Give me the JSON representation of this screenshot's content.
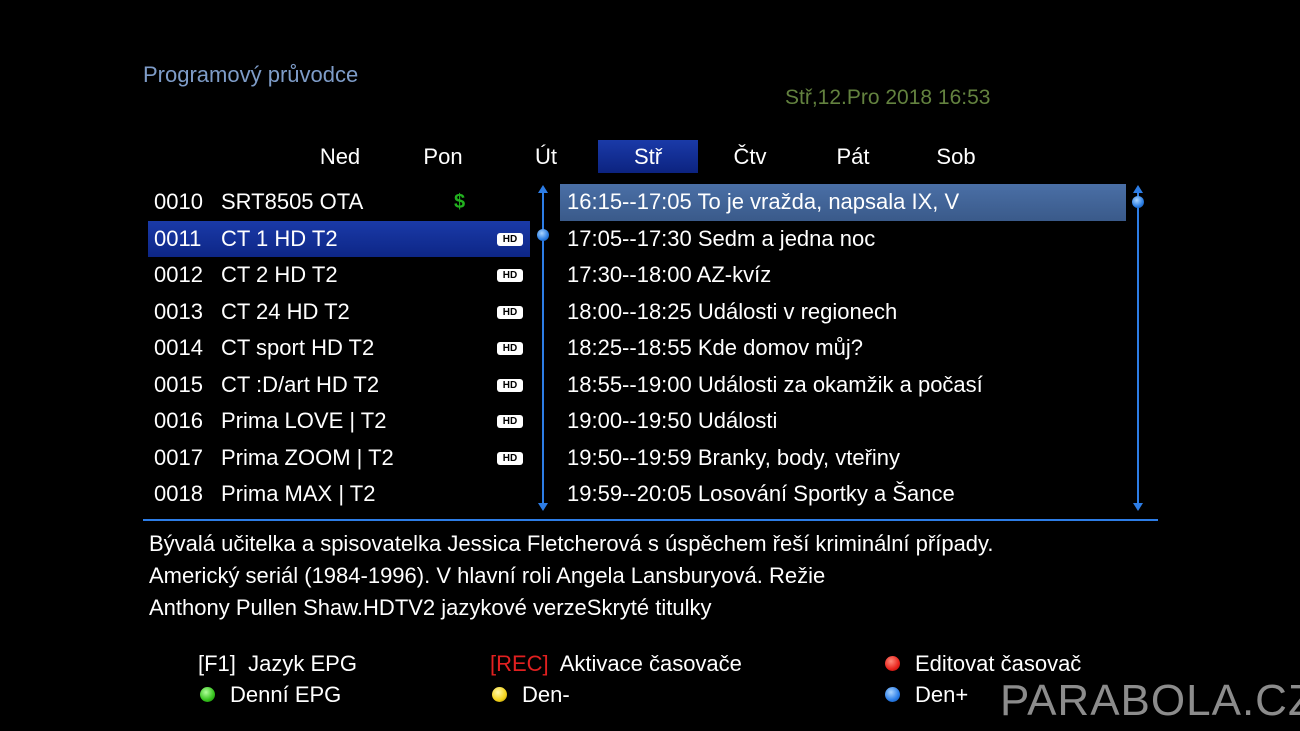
{
  "header": {
    "title": "Programový průvodce",
    "datetime": "Stř,12.Pro 2018 16:53"
  },
  "days": [
    {
      "label": "Ned",
      "active": false
    },
    {
      "label": "Pon",
      "active": false
    },
    {
      "label": "Út",
      "active": false
    },
    {
      "label": "Stř",
      "active": true
    },
    {
      "label": "Čtv",
      "active": false
    },
    {
      "label": "Pát",
      "active": false
    },
    {
      "label": "Sob",
      "active": false
    }
  ],
  "channels": [
    {
      "num": "0010",
      "name": "SRT8505 OTA",
      "badge": "$"
    },
    {
      "num": "0011",
      "name": "CT 1 HD T2",
      "badge": "HD"
    },
    {
      "num": "0012",
      "name": "CT 2 HD T2",
      "badge": "HD"
    },
    {
      "num": "0013",
      "name": "CT 24 HD T2",
      "badge": "HD"
    },
    {
      "num": "0014",
      "name": "CT sport HD T2",
      "badge": "HD"
    },
    {
      "num": "0015",
      "name": "CT :D/art HD T2",
      "badge": "HD"
    },
    {
      "num": "0016",
      "name": "Prima LOVE | T2",
      "badge": "HD"
    },
    {
      "num": "0017",
      "name": "Prima ZOOM | T2",
      "badge": "HD"
    },
    {
      "num": "0018",
      "name": "Prima MAX | T2",
      "badge": ""
    }
  ],
  "selected_channel": 1,
  "events": [
    "16:15--17:05 To je vražda, napsala IX, V",
    "17:05--17:30 Sedm a jedna noc",
    "17:30--18:00 AZ-kvíz",
    "18:00--18:25 Události v regionech",
    "18:25--18:55 Kde domov můj?",
    "18:55--19:00 Události za okamžik a počasí",
    "19:00--19:50 Události",
    "19:50--19:59 Branky, body, vteřiny",
    "19:59--20:05 Losování Sportky a Šance"
  ],
  "selected_event": 0,
  "description": [
    "Bývalá učitelka a spisovatelka Jessica Fletcherová s úspěchem řeší kriminální případy.",
    "Americký seriál (1984-1996). V hlavní roli Angela Lansburyová. Režie",
    "Anthony Pullen Shaw.HDTV2 jazykové verzeSkryté titulky"
  ],
  "legend": {
    "f1_key": "[F1]",
    "f1_label": "Jazyk EPG",
    "rec_key": "[REC]",
    "rec_label": "Aktivace časovače",
    "red_label": "Editovat časovač",
    "green_label": "Denní EPG",
    "yellow_label": "Den-",
    "blue_label": "Den+"
  },
  "colors": {
    "red": "#e8231c",
    "green": "#34c21c",
    "yellow": "#f2d21a",
    "blue": "#2a7de8",
    "highlight": "#1a3aa8"
  },
  "watermark": "PARABOLA.CZ"
}
